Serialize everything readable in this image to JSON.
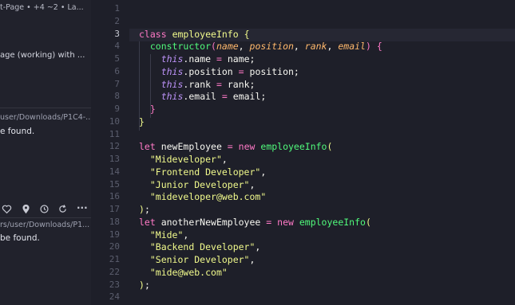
{
  "sidebar": {
    "tree_text": "t-Page • +4 ~2 • La...",
    "commit_message": "age (working) with ...",
    "result_1": {
      "path": "user/Downloads/P1C4-...",
      "message": "e found."
    },
    "result_2": {
      "path": "rs/user/Downloads/P1...",
      "message": "be found."
    },
    "toolbar_icons": [
      "heart-icon",
      "location-pin-icon",
      "history-icon",
      "refresh-icon",
      "more-icon"
    ],
    "more_label": "···"
  },
  "editor": {
    "line_numbers": [
      "1",
      "2",
      "3",
      "4",
      "5",
      "6",
      "7",
      "8",
      "9",
      "10",
      "11",
      "12",
      "13",
      "14",
      "15",
      "16",
      "17",
      "18",
      "19",
      "20",
      "21",
      "22",
      "23",
      "24"
    ],
    "current_line": 3,
    "lines": [
      {
        "n": 1,
        "tokens": []
      },
      {
        "n": 2,
        "tokens": []
      },
      {
        "n": 3,
        "tokens": [
          [
            "kw",
            "class"
          ],
          [
            "var",
            " "
          ],
          [
            "cls",
            "employeeInfo"
          ],
          [
            "var",
            " "
          ],
          [
            "brace-y",
            "{"
          ]
        ]
      },
      {
        "n": 4,
        "tokens": [
          [
            "var",
            "  "
          ],
          [
            "fn",
            "constructor"
          ],
          [
            "brace-p",
            "("
          ],
          [
            "param",
            "name"
          ],
          [
            "var",
            ", "
          ],
          [
            "param",
            "position"
          ],
          [
            "var",
            ", "
          ],
          [
            "param",
            "rank"
          ],
          [
            "var",
            ", "
          ],
          [
            "param",
            "email"
          ],
          [
            "brace-p",
            ")"
          ],
          [
            "var",
            " "
          ],
          [
            "brace-p",
            "{"
          ]
        ]
      },
      {
        "n": 5,
        "tokens": [
          [
            "var",
            "    "
          ],
          [
            "this",
            "this"
          ],
          [
            "var",
            "."
          ],
          [
            "prop",
            "name"
          ],
          [
            "var",
            " "
          ],
          [
            "op",
            "="
          ],
          [
            "var",
            " name;"
          ]
        ]
      },
      {
        "n": 6,
        "tokens": [
          [
            "var",
            "    "
          ],
          [
            "this",
            "this"
          ],
          [
            "var",
            "."
          ],
          [
            "prop",
            "position"
          ],
          [
            "var",
            " "
          ],
          [
            "op",
            "="
          ],
          [
            "var",
            " position;"
          ]
        ]
      },
      {
        "n": 7,
        "tokens": [
          [
            "var",
            "    "
          ],
          [
            "this",
            "this"
          ],
          [
            "var",
            "."
          ],
          [
            "prop",
            "rank"
          ],
          [
            "var",
            " "
          ],
          [
            "op",
            "="
          ],
          [
            "var",
            " rank;"
          ]
        ]
      },
      {
        "n": 8,
        "tokens": [
          [
            "var",
            "    "
          ],
          [
            "this",
            "this"
          ],
          [
            "var",
            "."
          ],
          [
            "prop",
            "email"
          ],
          [
            "var",
            " "
          ],
          [
            "op",
            "="
          ],
          [
            "var",
            " email;"
          ]
        ]
      },
      {
        "n": 9,
        "tokens": [
          [
            "var",
            "  "
          ],
          [
            "brace-p",
            "}"
          ]
        ]
      },
      {
        "n": 10,
        "tokens": [
          [
            "brace-y",
            "}"
          ]
        ]
      },
      {
        "n": 11,
        "tokens": []
      },
      {
        "n": 12,
        "tokens": [
          [
            "kw",
            "let"
          ],
          [
            "var",
            " newEmployee "
          ],
          [
            "op",
            "="
          ],
          [
            "var",
            " "
          ],
          [
            "kw",
            "new"
          ],
          [
            "var",
            " "
          ],
          [
            "fn",
            "employeeInfo"
          ],
          [
            "brace-y",
            "("
          ]
        ]
      },
      {
        "n": 13,
        "tokens": [
          [
            "var",
            "  "
          ],
          [
            "str",
            "\"Mideveloper\""
          ],
          [
            "var",
            ","
          ]
        ]
      },
      {
        "n": 14,
        "tokens": [
          [
            "var",
            "  "
          ],
          [
            "str",
            "\"Frontend Developer\""
          ],
          [
            "var",
            ","
          ]
        ]
      },
      {
        "n": 15,
        "tokens": [
          [
            "var",
            "  "
          ],
          [
            "str",
            "\"Junior Developer\""
          ],
          [
            "var",
            ","
          ]
        ]
      },
      {
        "n": 16,
        "tokens": [
          [
            "var",
            "  "
          ],
          [
            "str",
            "\"mideveloper@web.com\""
          ]
        ]
      },
      {
        "n": 17,
        "tokens": [
          [
            "brace-y",
            ")"
          ],
          [
            "var",
            ";"
          ]
        ]
      },
      {
        "n": 18,
        "tokens": [
          [
            "kw",
            "let"
          ],
          [
            "var",
            " anotherNewEmployee "
          ],
          [
            "op",
            "="
          ],
          [
            "var",
            " "
          ],
          [
            "kw",
            "new"
          ],
          [
            "var",
            " "
          ],
          [
            "fn",
            "employeeInfo"
          ],
          [
            "brace-y",
            "("
          ]
        ]
      },
      {
        "n": 19,
        "tokens": [
          [
            "var",
            "  "
          ],
          [
            "str",
            "\"Mide\""
          ],
          [
            "var",
            ","
          ]
        ]
      },
      {
        "n": 20,
        "tokens": [
          [
            "var",
            "  "
          ],
          [
            "str",
            "\"Backend Developer\""
          ],
          [
            "var",
            ","
          ]
        ]
      },
      {
        "n": 21,
        "tokens": [
          [
            "var",
            "  "
          ],
          [
            "str",
            "\"Senior Developer\""
          ],
          [
            "var",
            ","
          ]
        ]
      },
      {
        "n": 22,
        "tokens": [
          [
            "var",
            "  "
          ],
          [
            "str",
            "\"mide@web.com\""
          ]
        ]
      },
      {
        "n": 23,
        "tokens": [
          [
            "brace-y",
            ")"
          ],
          [
            "var",
            ";"
          ]
        ]
      },
      {
        "n": 24,
        "tokens": []
      }
    ]
  },
  "colors": {
    "background": "#1e1f29",
    "sidebar": "#21222c",
    "keyword": "#ff79c6",
    "class_name": "#f1fa8c",
    "function": "#50fa7b",
    "parameter": "#ffb86c",
    "this": "#bd93f9",
    "string": "#f1fa8c",
    "line_number": "#5b5e6e"
  }
}
